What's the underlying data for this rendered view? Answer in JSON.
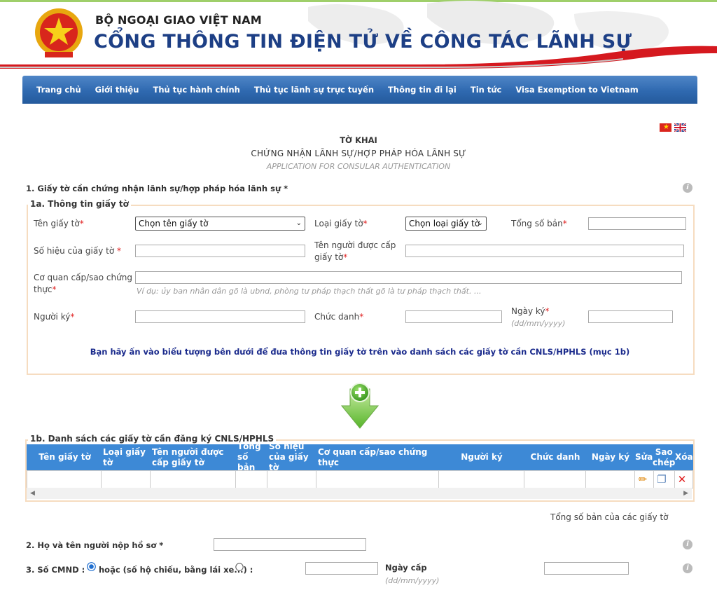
{
  "header": {
    "ministry": "BỘ NGOẠI GIAO VIỆT NAM",
    "portal": "CỔNG THÔNG TIN ĐIỆN TỬ VỀ CÔNG TÁC LÃNH SỰ"
  },
  "nav": {
    "items": [
      {
        "label": "Trang chủ"
      },
      {
        "label": "Giới thiệu"
      },
      {
        "label": "Thủ tục hành chính"
      },
      {
        "label": "Thủ tục lãnh sự trực tuyến"
      },
      {
        "label": "Thông tin đi lại"
      },
      {
        "label": "Tin tức"
      },
      {
        "label": "Visa Exemption to Vietnam"
      }
    ]
  },
  "title": {
    "line1": "TỜ KHAI",
    "line2": "CHỨNG NHẬN LÃNH SỰ/HỢP PHÁP HÓA LÃNH SỰ",
    "line3": "APPLICATION FOR CONSULAR AUTHENTICATION"
  },
  "section1": {
    "label": "1. Giấy tờ cần chứng nhận lãnh sự/hợp pháp hóa lãnh sự *",
    "legend_1a": "1a. Thông tin giấy tờ",
    "fields": {
      "ten_giay_to": "Tên giấy tờ",
      "ten_giay_to_select": "Chọn tên giấy tờ",
      "loai_giay_to": "Loại giấy tờ",
      "loai_giay_to_select": "Chọn loại giấy tờ",
      "tong_so_ban": "Tổng số bản",
      "so_hieu": "Số hiệu của giấy tờ ",
      "ten_nguoi_duoc_cap_1": "Tên người được cấp",
      "ten_nguoi_duoc_cap_2": "giấy tờ",
      "co_quan_1": "Cơ quan cấp/sao chứng",
      "co_quan_2": "thực",
      "co_quan_hint": "Ví dụ: ủy ban nhân dân gõ là ubnd, phòng tư pháp thạch thất gõ là tư pháp thạch thất. ...",
      "nguoi_ky": "Người ký",
      "chuc_danh": "Chức danh",
      "ngay_ky": "Ngày ký",
      "ngay_ky_hint": "(dd/mm/yyyy)",
      "required_mark": "*"
    },
    "note": "Bạn hãy ấn vào biểu tượng bên dưới để đưa thông tin giấy tờ trên vào danh sách các giấy tờ cần CNLS/HPHLS (mục 1b)",
    "legend_1b": "1b. Danh sách các giấy tờ cần đăng ký CNLS/HPHLS",
    "table": {
      "columns": [
        {
          "l1": "Tên giấy tờ",
          "l2": ""
        },
        {
          "l1": "Loại giấy",
          "l2": "tờ"
        },
        {
          "l1": "Tên người được",
          "l2": "cấp giấy tờ"
        },
        {
          "l1": "Tổng",
          "l2": "số bản"
        },
        {
          "l1": "Số hiệu",
          "l2": "của giấy tờ"
        },
        {
          "l1": "Cơ quan cấp/sao chứng",
          "l2": "thực"
        },
        {
          "l1": "Người ký",
          "l2": ""
        },
        {
          "l1": "Chức danh",
          "l2": ""
        },
        {
          "l1": "Ngày ký",
          "l2": ""
        },
        {
          "l1": "Sửa",
          "l2": ""
        },
        {
          "l1": "Sao",
          "l2": "chép"
        },
        {
          "l1": "Xóa",
          "l2": ""
        }
      ]
    },
    "total_label": "Tổng số bản của các giấy tờ"
  },
  "section2": {
    "label": "2. Họ và tên người nộp hồ sơ *"
  },
  "section3": {
    "label": "3. Số CMND : *",
    "alt_label": "hoặc (số hộ chiếu, bằng lái xe...) :",
    "ngay_cap": "Ngày cấp",
    "ngay_cap_hint": "(dd/mm/yyyy)"
  },
  "icons": {
    "info": "i",
    "edit": "✏",
    "copy": "❐",
    "delete": "✕",
    "select_arrow": "⌄",
    "scroll_left": "◀",
    "scroll_right": "▶"
  },
  "colors": {
    "nav": "#2f69b0",
    "table_header": "#3d89d6",
    "fieldset_border": "#f6dcc0",
    "note": "#1a2a8c",
    "required": "#e02020"
  }
}
